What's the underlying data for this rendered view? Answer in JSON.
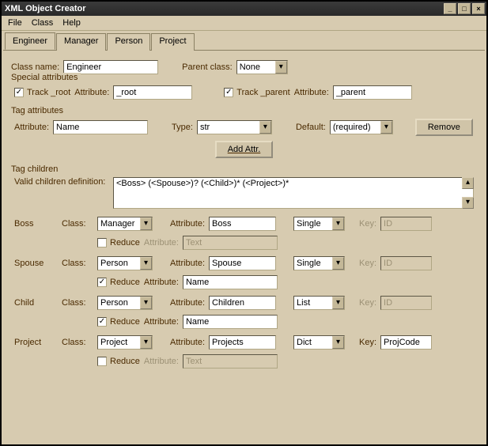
{
  "window": {
    "title": "XML Object Creator"
  },
  "menu": {
    "file": "File",
    "class": "Class",
    "help": "Help"
  },
  "tabs": {
    "engineer": "Engineer",
    "manager": "Manager",
    "person": "Person",
    "project": "Project"
  },
  "class_row": {
    "class_name_label": "Class name:",
    "class_name_value": "Engineer",
    "parent_class_label": "Parent class:",
    "parent_class_value": "None"
  },
  "special": {
    "legend": "Special attributes",
    "track_root_label": "Track _root",
    "root_attr_label": "Attribute:",
    "root_attr_value": "_root",
    "track_parent_label": "Track _parent",
    "parent_attr_label": "Attribute:",
    "parent_attr_value": "_parent"
  },
  "tag_attrs": {
    "legend": "Tag attributes",
    "attribute_label": "Attribute:",
    "attribute_value": "Name",
    "type_label": "Type:",
    "type_value": "str",
    "default_label": "Default:",
    "default_value": "(required)",
    "remove_label": "Remove",
    "add_label": "Add Attr."
  },
  "tag_children": {
    "legend": "Tag children",
    "valid_def_label": "Valid children definition:",
    "valid_def_value": "<Boss> (<Spouse>)? (<Child>)* (<Project>)*",
    "rows": {
      "boss": {
        "name": "Boss",
        "class_label": "Class:",
        "class_value": "Manager",
        "attr_label": "Attribute:",
        "attr_value": "Boss",
        "collect_value": "Single",
        "key_label": "Key:",
        "key_value": "ID",
        "reduce_label": "Reduce",
        "reduce_attr_label": "Attribute:",
        "reduce_attr_value": "Text"
      },
      "spouse": {
        "name": "Spouse",
        "class_label": "Class:",
        "class_value": "Person",
        "attr_label": "Attribute:",
        "attr_value": "Spouse",
        "collect_value": "Single",
        "key_label": "Key:",
        "key_value": "ID",
        "reduce_label": "Reduce",
        "reduce_attr_label": "Attribute:",
        "reduce_attr_value": "Name"
      },
      "child": {
        "name": "Child",
        "class_label": "Class:",
        "class_value": "Person",
        "attr_label": "Attribute:",
        "attr_value": "Children",
        "collect_value": "List",
        "key_label": "Key:",
        "key_value": "ID",
        "reduce_label": "Reduce",
        "reduce_attr_label": "Attribute:",
        "reduce_attr_value": "Name"
      },
      "project": {
        "name": "Project",
        "class_label": "Class:",
        "class_value": "Project",
        "attr_label": "Attribute:",
        "attr_value": "Projects",
        "collect_value": "Dict",
        "key_label": "Key:",
        "key_value": "ProjCode",
        "reduce_label": "Reduce",
        "reduce_attr_label": "Attribute:",
        "reduce_attr_value": "Text"
      }
    }
  }
}
